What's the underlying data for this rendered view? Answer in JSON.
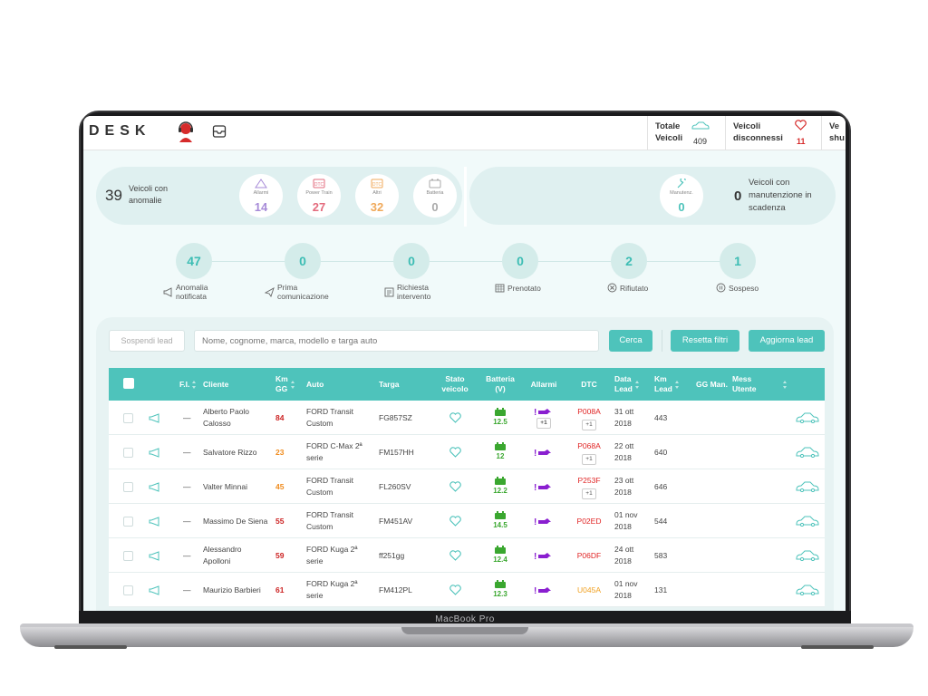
{
  "device": {
    "label": "MacBook Pro"
  },
  "topbar": {
    "logo": "DESK",
    "stats": [
      {
        "label_line1": "Totale",
        "label_line2": "Veicoli",
        "value": "409",
        "icon": "car-icon"
      },
      {
        "label_line1": "Veicoli",
        "label_line2": "disconnessi",
        "value": "11",
        "icon": "heart-icon"
      },
      {
        "label_line1": "Ve",
        "label_line2": "shu",
        "value": "",
        "icon": ""
      }
    ]
  },
  "anomalies": {
    "count": "39",
    "label": "Veicoli con anomalie",
    "bubbles": [
      {
        "label": "Allarmi",
        "value": "14",
        "color": "#a78bd8",
        "icon": "warning-icon"
      },
      {
        "label": "Power Train",
        "value": "27",
        "color": "#e36b7d",
        "icon": "dtc-icon"
      },
      {
        "label": "Altri",
        "value": "32",
        "color": "#f0a95a",
        "icon": "dtc-icon"
      },
      {
        "label": "Batteria",
        "value": "0",
        "color": "#aaaaaa",
        "icon": "battery-icon"
      }
    ]
  },
  "maintenance": {
    "count": "0",
    "label": "Veicoli con manutenzione in scadenza",
    "bubble": {
      "label": "Manutenz.",
      "value": "0",
      "color": "#4ec3bb",
      "icon": "wrench-icon"
    }
  },
  "steps": [
    {
      "value": "47",
      "label1": "Anomalia",
      "label2": "notificata",
      "icon": "megaphone-icon"
    },
    {
      "value": "0",
      "label1": "Prima",
      "label2": "comunicazione",
      "icon": "send-icon"
    },
    {
      "value": "0",
      "label1": "Richiesta",
      "label2": "intervento",
      "icon": "form-icon"
    },
    {
      "value": "0",
      "label1": "Prenotato",
      "label2": "",
      "icon": "calendar-icon"
    },
    {
      "value": "2",
      "label1": "Rifiutato",
      "label2": "",
      "icon": "cancel-icon"
    },
    {
      "value": "1",
      "label1": "Sospeso",
      "label2": "",
      "icon": "pause-icon"
    }
  ],
  "toolbar": {
    "suspend_label": "Sospendi lead",
    "search_placeholder": "Nome, cognome, marca, modello e targa auto",
    "search_label": "Cerca",
    "reset_label": "Resetta filtri",
    "update_label": "Aggiorna lead"
  },
  "table": {
    "headers": {
      "fi": "F.I.",
      "cliente": "Cliente",
      "km_gg": [
        "Km",
        "GG"
      ],
      "auto": "Auto",
      "targa": "Targa",
      "stato": [
        "Stato",
        "veicolo"
      ],
      "batteria": [
        "Batteria",
        "(V)"
      ],
      "allarmi": "Allarmi",
      "dtc": "DTC",
      "data_lead": [
        "Data",
        "Lead"
      ],
      "km_lead": [
        "Km",
        "Lead"
      ],
      "gg_man": "GG Man.",
      "mess_utente": [
        "Mess",
        "Utente"
      ]
    },
    "rows": [
      {
        "fi": "—",
        "cliente": [
          "Alberto Paolo",
          "Calosso"
        ],
        "km_gg": "84",
        "km_color": "#cc2222",
        "auto": [
          "FORD Transit",
          "Custom"
        ],
        "targa": "FG857SZ",
        "batteria": "12.5",
        "alarm_extra": "+1",
        "dtc": "P008A",
        "dtc_extra": "+1",
        "dtc_color": "#e02424",
        "data": [
          "31 ott",
          "2018"
        ],
        "km_lead": "443"
      },
      {
        "fi": "—",
        "cliente": [
          "Salvatore Rizzo",
          ""
        ],
        "km_gg": "23",
        "km_color": "#f08c1e",
        "auto": [
          "FORD C-Max 2ª",
          "serie"
        ],
        "targa": "FM157HH",
        "batteria": "12",
        "alarm_extra": "",
        "dtc": "P068A",
        "dtc_extra": "+1",
        "dtc_color": "#e02424",
        "data": [
          "22 ott",
          "2018"
        ],
        "km_lead": "640"
      },
      {
        "fi": "—",
        "cliente": [
          "Valter Minnai",
          ""
        ],
        "km_gg": "45",
        "km_color": "#f08c1e",
        "auto": [
          "FORD Transit",
          "Custom"
        ],
        "targa": "FL260SV",
        "batteria": "12.2",
        "alarm_extra": "",
        "dtc": "P253F",
        "dtc_extra": "+1",
        "dtc_color": "#e02424",
        "data": [
          "23 ott",
          "2018"
        ],
        "km_lead": "646"
      },
      {
        "fi": "—",
        "cliente": [
          "Massimo De Siena",
          ""
        ],
        "km_gg": "55",
        "km_color": "#cc2222",
        "auto": [
          "FORD Transit",
          "Custom"
        ],
        "targa": "FM451AV",
        "batteria": "14.5",
        "alarm_extra": "",
        "dtc": "P02ED",
        "dtc_extra": "",
        "dtc_color": "#e02424",
        "data": [
          "01 nov",
          "2018"
        ],
        "km_lead": "544"
      },
      {
        "fi": "—",
        "cliente": [
          "Alessandro",
          "Apolloni"
        ],
        "km_gg": "59",
        "km_color": "#cc2222",
        "auto": [
          "FORD Kuga 2ª",
          "serie"
        ],
        "targa": "ff251gg",
        "batteria": "12.4",
        "alarm_extra": "",
        "dtc": "P06DF",
        "dtc_extra": "",
        "dtc_color": "#e02424",
        "data": [
          "24 ott",
          "2018"
        ],
        "km_lead": "583"
      },
      {
        "fi": "—",
        "cliente": [
          "Maurizio Barbieri",
          ""
        ],
        "km_gg": "61",
        "km_color": "#cc2222",
        "auto": [
          "FORD Kuga 2ª",
          "serie"
        ],
        "targa": "FM412PL",
        "batteria": "12.3",
        "alarm_extra": "",
        "dtc": "U045A",
        "dtc_extra": "",
        "dtc_color": "#f0a020",
        "data": [
          "01 nov",
          "2018"
        ],
        "km_lead": "131"
      }
    ]
  },
  "colors": {
    "accent": "#4ec3bb",
    "alarm": "#8a1fd0",
    "battery": "#3aa72f"
  }
}
